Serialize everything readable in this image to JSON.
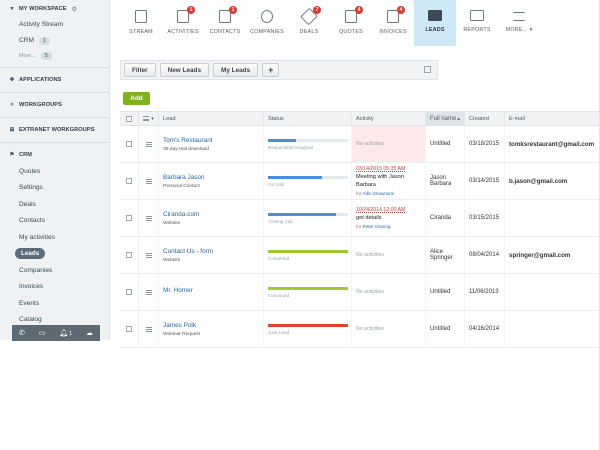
{
  "sidebar": {
    "workspace": "MY WORKSPACE",
    "items_top": [
      {
        "label": "Activity Stream"
      },
      {
        "label": "CRM",
        "count": "1"
      },
      {
        "label": "More...",
        "count": "5"
      }
    ],
    "applications": "APPLICATIONS",
    "workgroups": "WORKGROUPS",
    "extranet": "EXTRANET WORKGROUPS",
    "crm": "CRM",
    "crm_items": [
      "Quotes",
      "Settings",
      "Deals",
      "Contacts",
      "My activities",
      "Leads",
      "Companies",
      "Invoices",
      "Events",
      "Catalog"
    ],
    "footer_count": "1"
  },
  "nav": [
    {
      "label": "STREAM",
      "badge": ""
    },
    {
      "label": "ACTIVITIES",
      "badge": "1"
    },
    {
      "label": "CONTACTS",
      "badge": "1"
    },
    {
      "label": "COMPANIES",
      "badge": ""
    },
    {
      "label": "DEALS",
      "badge": "7"
    },
    {
      "label": "QUOTES",
      "badge": "4"
    },
    {
      "label": "INVOICES",
      "badge": "4"
    },
    {
      "label": "LEADS",
      "badge": ""
    },
    {
      "label": "REPORTS",
      "badge": ""
    },
    {
      "label": "MORE...",
      "badge": ""
    }
  ],
  "toolbar": {
    "filter": "Filter",
    "new_leads": "New Leads",
    "my_leads": "My Leads",
    "plus": "+"
  },
  "add_label": "Add",
  "columns": {
    "lead": "Lead",
    "status": "Status",
    "activity": "Activity",
    "fullname": "Full name",
    "created": "Created",
    "email": "E-mail"
  },
  "colors": {
    "blue": "#4a90d9",
    "green": "#9fc92f",
    "red": "#e2412e",
    "active_tab": "#cfe8f6"
  },
  "rows": [
    {
      "lead": "Tom's Restaurant",
      "sub": "30-day-trial download",
      "status": "Responsible Assigned",
      "status_color": "#4a90d9",
      "status_fill": 0.35,
      "act_none": "No activities",
      "act_date": "",
      "act_title": "",
      "act_for_prefix": "",
      "act_for": "",
      "fullname": "Untitled",
      "created": "03/18/2015",
      "email": "tomksrestaurant@gmail.com"
    },
    {
      "lead": "Barbara Jason",
      "sub": "Personal Contact",
      "status": "On hold",
      "status_color": "#4a90d9",
      "status_fill": 0.68,
      "act_none": "",
      "act_date": "03/14/2015 05:35 AM",
      "act_title": "Meeting with Jason Barbara",
      "act_for_prefix": "for",
      "act_for": "Adin Showmick",
      "fullname": "Jason Barbara",
      "created": "03/14/2015",
      "email": "b.jason@gmail.com"
    },
    {
      "lead": "Ciranda.com",
      "sub": "Website",
      "status": "Closing Call",
      "status_color": "#4a90d9",
      "status_fill": 0.85,
      "act_none": "",
      "act_date": "10/24/2014 12:00 AM",
      "act_title": "get details",
      "act_for_prefix": "for",
      "act_for": "Peter Glosing",
      "fullname": "Ciranda",
      "created": "03/15/2015",
      "email": ""
    },
    {
      "lead": "Contact Us - form",
      "sub": "Website",
      "status": "Converted",
      "status_color": "#9fc92f",
      "status_fill": 1,
      "act_none": "No activities",
      "act_date": "",
      "act_title": "",
      "act_for_prefix": "",
      "act_for": "",
      "fullname": "Alice Springer",
      "created": "08/04/2014",
      "email": "springer@gmail.com"
    },
    {
      "lead": "Mr. Homer",
      "sub": "",
      "status": "Converted",
      "status_color": "#9fc92f",
      "status_fill": 1,
      "act_none": "No activities",
      "act_date": "",
      "act_title": "",
      "act_for_prefix": "",
      "act_for": "",
      "fullname": "Untitled",
      "created": "11/06/2013",
      "email": ""
    },
    {
      "lead": "James Polk",
      "sub": "Webinar Request",
      "status": "Junk Lead",
      "status_color": "#e2412e",
      "status_fill": 1,
      "act_none": "No activities",
      "act_date": "",
      "act_title": "",
      "act_for_prefix": "",
      "act_for": "",
      "fullname": "Untitled",
      "created": "04/16/2014",
      "email": ""
    }
  ]
}
